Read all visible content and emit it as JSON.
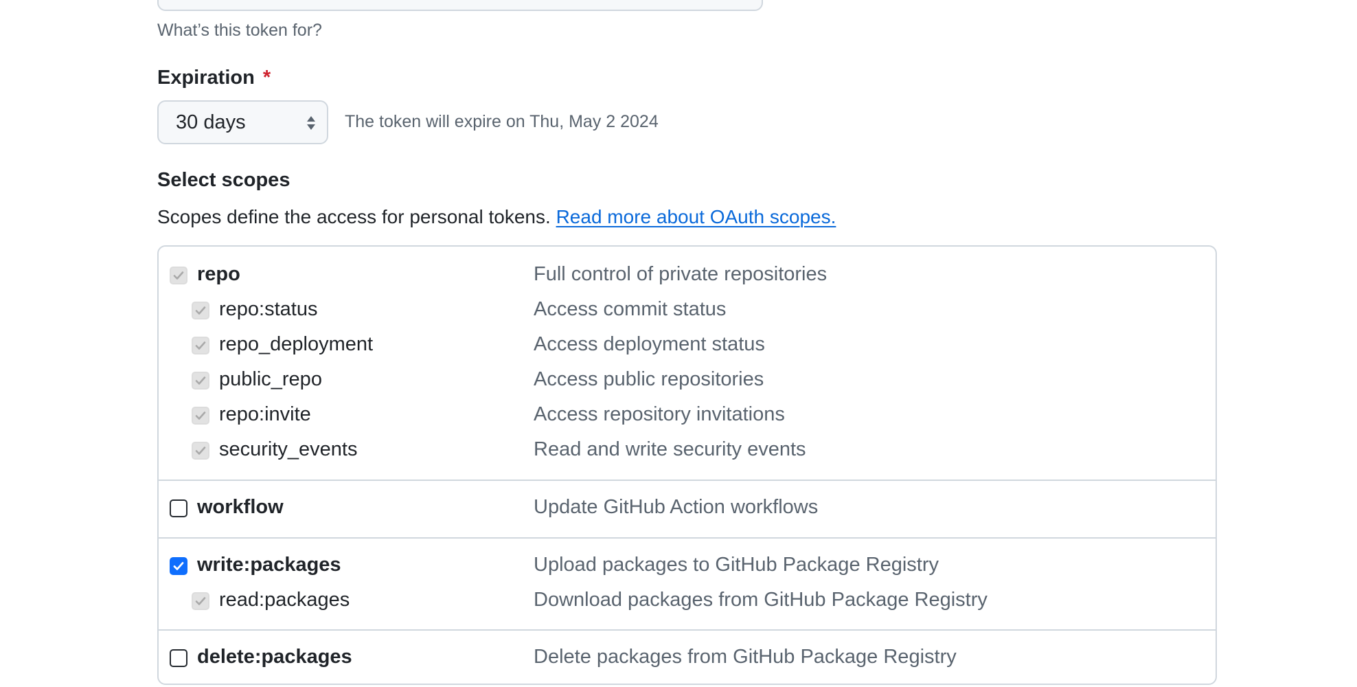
{
  "note": {
    "hint": "What’s this token for?"
  },
  "expiration": {
    "label": "Expiration",
    "required_marker": "*",
    "selected": "30 days",
    "note": "The token will expire on Thu, May 2 2024"
  },
  "scopes": {
    "heading": "Select scopes",
    "description": "Scopes define the access for personal tokens.",
    "link_text": "Read more about OAuth scopes.",
    "groups": [
      {
        "rows": [
          {
            "name": "repo",
            "description": "Full control of private repositories",
            "state": "disabled-checked"
          },
          {
            "name": "repo:status",
            "description": "Access commit status",
            "state": "disabled-checked"
          },
          {
            "name": "repo_deployment",
            "description": "Access deployment status",
            "state": "disabled-checked"
          },
          {
            "name": "public_repo",
            "description": "Access public repositories",
            "state": "disabled-checked"
          },
          {
            "name": "repo:invite",
            "description": "Access repository invitations",
            "state": "disabled-checked"
          },
          {
            "name": "security_events",
            "description": "Read and write security events",
            "state": "disabled-checked"
          }
        ]
      },
      {
        "rows": [
          {
            "name": "workflow",
            "description": "Update GitHub Action workflows",
            "state": "unchecked"
          }
        ]
      },
      {
        "rows": [
          {
            "name": "write:packages",
            "description": "Upload packages to GitHub Package Registry",
            "state": "checked"
          },
          {
            "name": "read:packages",
            "description": "Download packages from GitHub Package Registry",
            "state": "disabled-checked"
          }
        ]
      },
      {
        "rows": [
          {
            "name": "delete:packages",
            "description": "Delete packages from GitHub Package Registry",
            "state": "unchecked"
          }
        ]
      }
    ]
  },
  "colors": {
    "accent": "#0969da",
    "checkbox_checked": "#0f6efd",
    "required": "#cf222e",
    "muted_text": "#59636e",
    "border": "#d0d7de"
  }
}
